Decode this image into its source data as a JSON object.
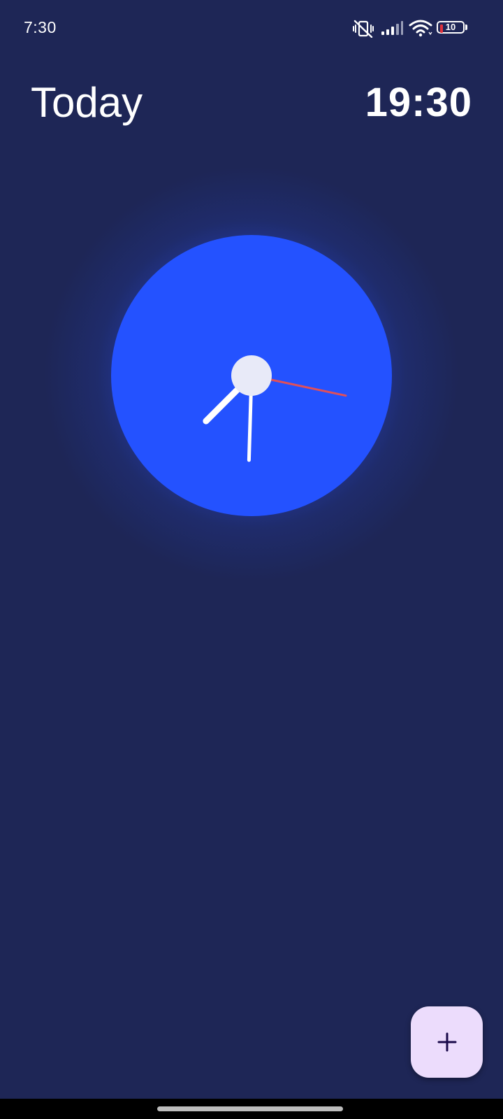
{
  "status_bar": {
    "time": "7:30",
    "battery_level": "10",
    "icons": [
      "vibrate-mute-icon",
      "signal-icon",
      "wifi-icon",
      "battery-icon"
    ]
  },
  "header": {
    "title": "Today",
    "digital_time": "19:30"
  },
  "clock": {
    "hour": 7,
    "minute": 30,
    "second": 17,
    "face_color": "#2452ff",
    "hub_color": "#e8eaf8",
    "hand_color": "#ffffff",
    "second_hand_color": "#e0505a"
  },
  "fab": {
    "icon": "plus-icon",
    "color": "#ecdcfc",
    "icon_color": "#1a0a4a"
  },
  "colors": {
    "background": "#1e2656",
    "accent": "#2452ff"
  }
}
